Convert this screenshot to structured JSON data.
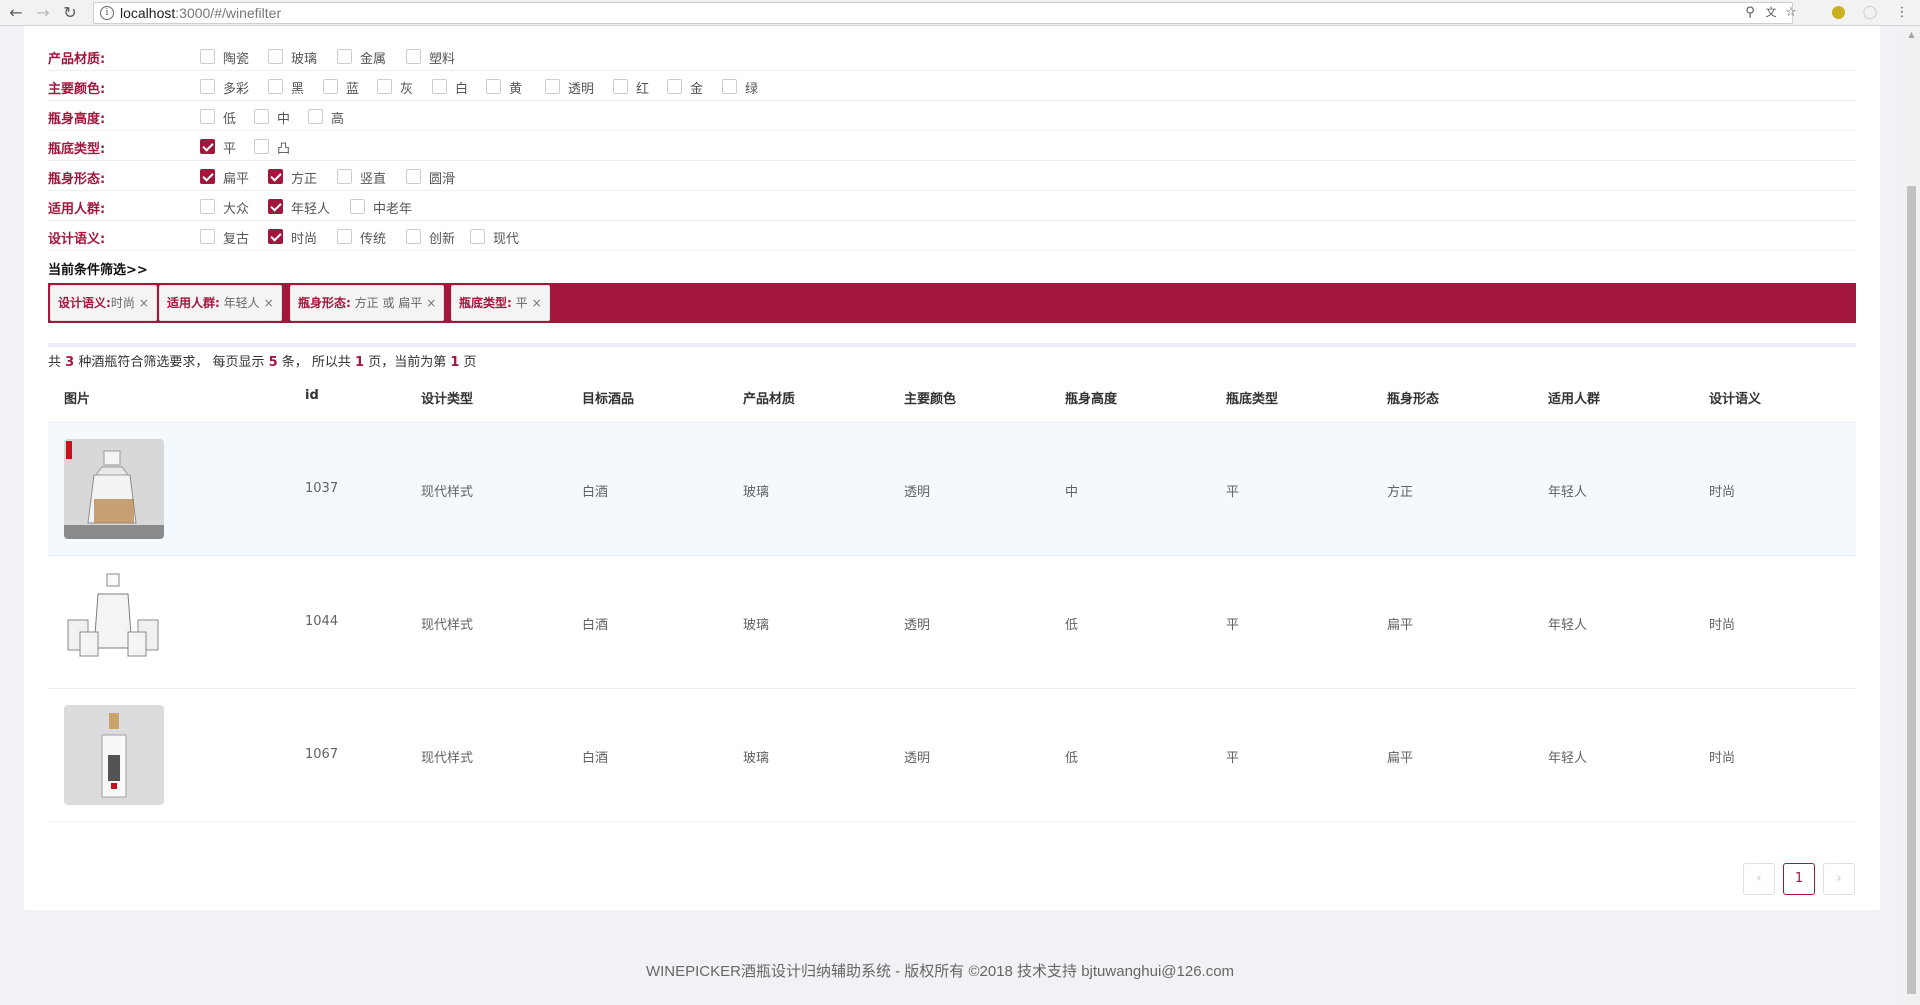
{
  "browser": {
    "url_host": "localhost",
    "url_path": ":3000/#/winefilter"
  },
  "filters": [
    {
      "label": "产品材质:",
      "options": [
        {
          "text": "陶瓷",
          "checked": false
        },
        {
          "text": "玻璃",
          "checked": false
        },
        {
          "text": "金属",
          "checked": false
        },
        {
          "text": "塑料",
          "checked": false
        }
      ]
    },
    {
      "label": "主要颜色:",
      "options": [
        {
          "text": "多彩",
          "checked": false
        },
        {
          "text": "黑",
          "checked": false
        },
        {
          "text": "蓝",
          "checked": false
        },
        {
          "text": "灰",
          "checked": false
        },
        {
          "text": "白",
          "checked": false
        },
        {
          "text": "黄",
          "checked": false
        },
        {
          "text": "透明",
          "checked": false
        },
        {
          "text": "红",
          "checked": false
        },
        {
          "text": "金",
          "checked": false
        },
        {
          "text": "绿",
          "checked": false
        }
      ]
    },
    {
      "label": "瓶身高度:",
      "options": [
        {
          "text": "低",
          "checked": false
        },
        {
          "text": "中",
          "checked": false
        },
        {
          "text": "高",
          "checked": false
        }
      ]
    },
    {
      "label": "瓶底类型:",
      "options": [
        {
          "text": "平",
          "checked": true
        },
        {
          "text": "凸",
          "checked": false
        }
      ]
    },
    {
      "label": "瓶身形态:",
      "options": [
        {
          "text": "扁平",
          "checked": true
        },
        {
          "text": "方正",
          "checked": true
        },
        {
          "text": "竖直",
          "checked": false
        },
        {
          "text": "圆滑",
          "checked": false
        }
      ]
    },
    {
      "label": "适用人群:",
      "options": [
        {
          "text": "大众",
          "checked": false
        },
        {
          "text": "年轻人",
          "checked": true
        },
        {
          "text": "中老年",
          "checked": false
        }
      ]
    },
    {
      "label": "设计语义:",
      "options": [
        {
          "text": "复古",
          "checked": false
        },
        {
          "text": "时尚",
          "checked": true
        },
        {
          "text": "传统",
          "checked": false
        },
        {
          "text": "创新",
          "checked": false
        },
        {
          "text": "现代",
          "checked": false
        }
      ]
    }
  ],
  "current_filter_title": "当前条件筛选>>",
  "tags": [
    {
      "key": "设计语义:",
      "value": "时尚"
    },
    {
      "key": "适用人群:",
      "value": "年轻人"
    },
    {
      "key": "瓶身形态:",
      "value": "方正 或 扁平"
    },
    {
      "key": "瓶底类型:",
      "value": "平"
    }
  ],
  "summary": {
    "p1": "共 ",
    "total": "3",
    "p2": " 种酒瓶符合筛选要求， 每页显示 ",
    "per_page": "5",
    "p3": " 条， 所以共 ",
    "pages": "1",
    "p4": " 页，当前为第 ",
    "current": "1",
    "p5": " 页"
  },
  "table": {
    "headers": [
      "图片",
      "id",
      "设计类型",
      "目标酒品",
      "产品材质",
      "主要颜色",
      "瓶身高度",
      "瓶底类型",
      "瓶身形态",
      "适用人群",
      "设计语义"
    ],
    "rows": [
      [
        "",
        "1037",
        "现代样式",
        "白酒",
        "玻璃",
        "透明",
        "中",
        "平",
        "方正",
        "年轻人",
        "时尚"
      ],
      [
        "",
        "1044",
        "现代样式",
        "白酒",
        "玻璃",
        "透明",
        "低",
        "平",
        "扁平",
        "年轻人",
        "时尚"
      ],
      [
        "",
        "1067",
        "现代样式",
        "白酒",
        "玻璃",
        "透明",
        "低",
        "平",
        "扁平",
        "年轻人",
        "时尚"
      ]
    ]
  },
  "pagination": {
    "prev": "‹",
    "page": "1",
    "next": "›"
  },
  "footer": "WINEPICKER酒瓶设计归纳辅助系统 - 版权所有 ©2018 技术支持 bjtuwanghui@126.com",
  "colors": {
    "accent": "#a3173d",
    "highlight_row": "#f3f9fd"
  }
}
